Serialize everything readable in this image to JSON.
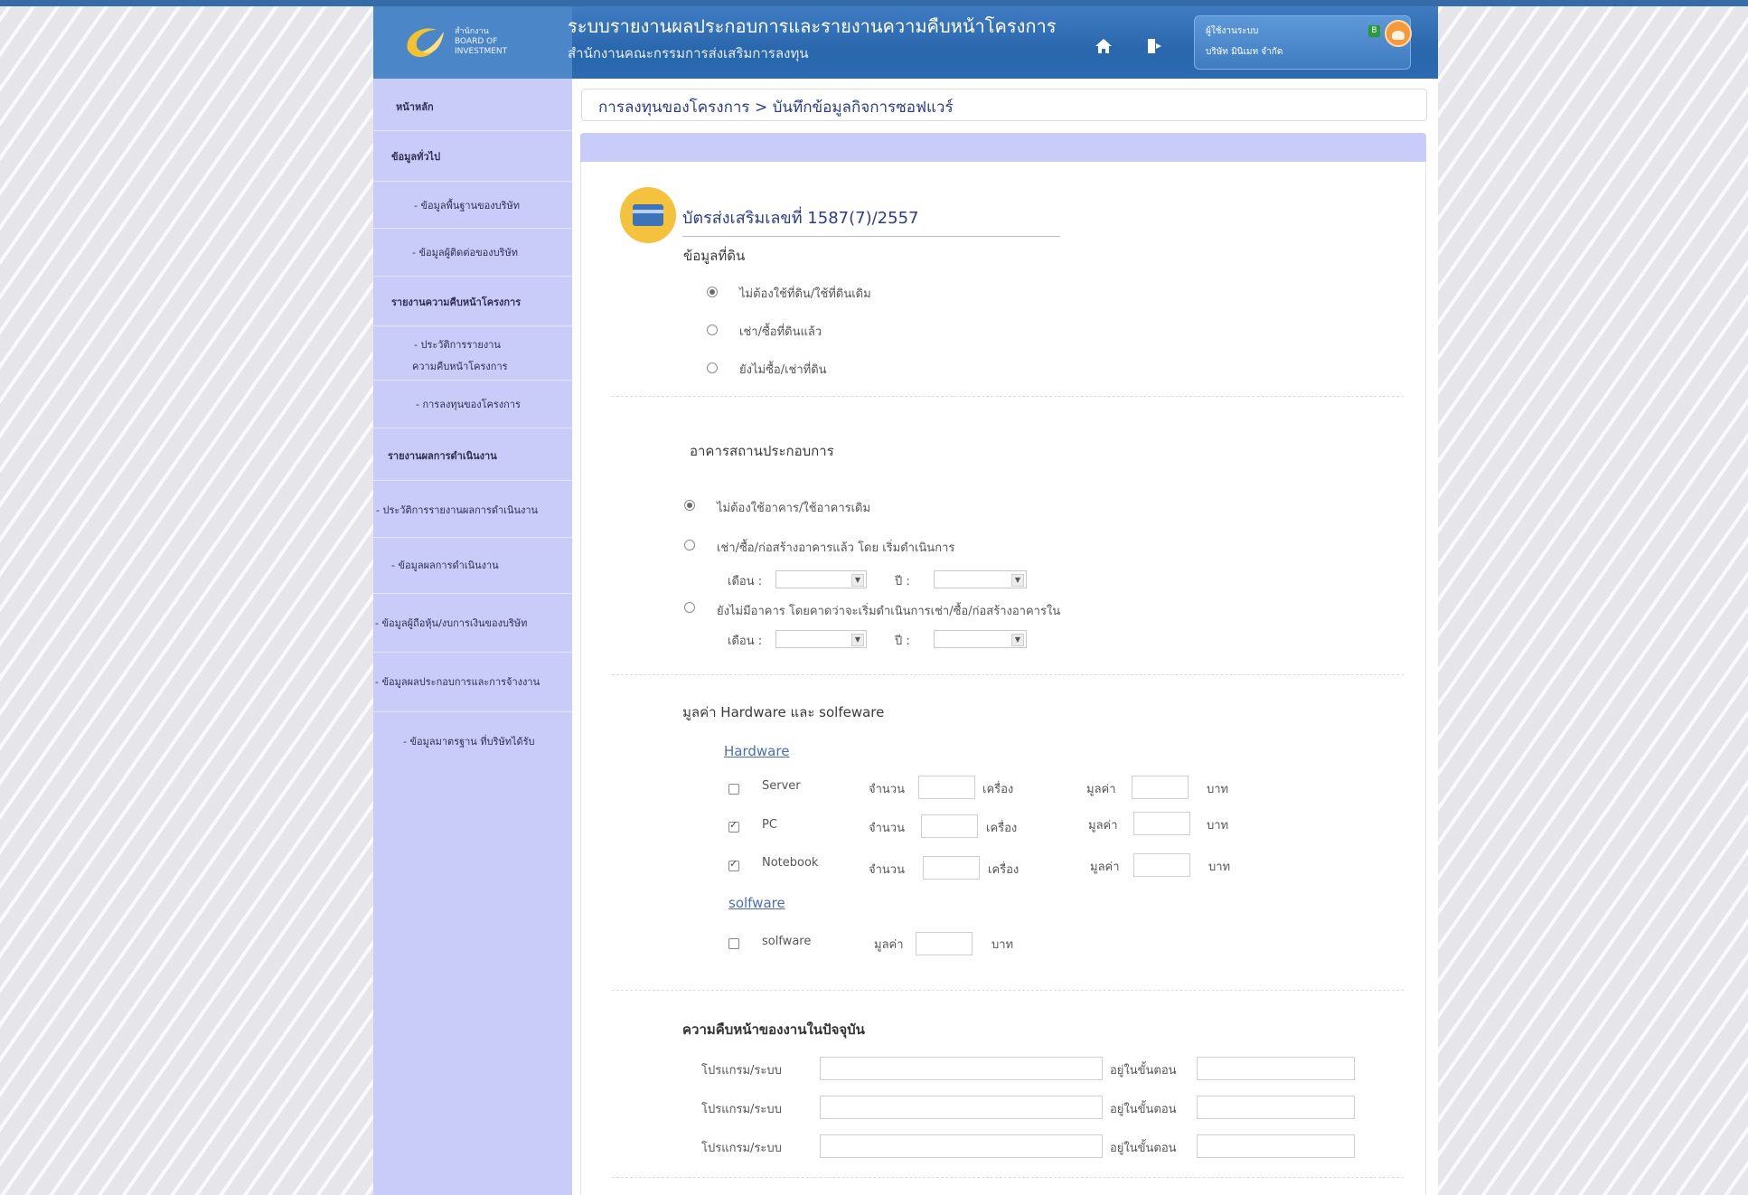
{
  "header": {
    "logo_line1": "สำนักงาน",
    "logo_line2": "BOARD OF",
    "logo_line3": "INVESTMENT",
    "system_title": "ระบบรายงานผลประกอบการและรายงานความคืบหน้าโครงการ",
    "system_subtitle": "สำนักงานคณะกรรมการส่งเสริมการลงทุน",
    "home_icon": "home-icon",
    "logout_icon": "logout-icon",
    "user_label": "ผู้ใช้งานระบบ",
    "user_company": "บริษัท มินิเมท จำกัด",
    "user_badge": "B",
    "accent": "#2b69b0"
  },
  "sidebar": {
    "items": [
      {
        "label": "หน้าหลัก"
      },
      {
        "label": "ข้อมูลทั่วไป"
      },
      {
        "label": "- ข้อมูลพื้นฐานของบริษัท"
      },
      {
        "label": "- ข้อมูลผู้ติดต่อของบริษัท"
      },
      {
        "label": "รายงานความคืบหน้าโครงการ"
      },
      {
        "label": "- ประวัติการรายงาน"
      },
      {
        "label": "ความคืบหน้าโครงการ"
      },
      {
        "label": "- การลงทุนของโครงการ"
      },
      {
        "label": "รายงานผลการดำเนินงาน"
      },
      {
        "label": "- ประวัติการรายงานผลการดำเนินงาน"
      },
      {
        "label": "- ข้อมูลผลการดำเนินงาน"
      },
      {
        "label": "- ข้อมูลผู้ถือหุ้น/งบการเงินของบริษัท"
      },
      {
        "label": "- ข้อมูลผลประกอบการและการจ้างงาน"
      },
      {
        "label": "- ข้อมูลมาตรฐาน ที่บริษัทได้รับ"
      }
    ],
    "bg": "#c9cbf8"
  },
  "breadcrumb": "การลงทุนของโครงการ > บันทึกข้อมูลกิจการซอฟแวร์",
  "card": {
    "title": "บัตรส่งเสริมเลขที่ 1587(7)/2557",
    "icon": "card-icon"
  },
  "land": {
    "title": "ข้อมูลที่ดิน",
    "options": [
      {
        "label": "ไม่ต้องใช้ที่ดิน/ใช้ที่ดินเดิม",
        "checked": true
      },
      {
        "label": "เช่า/ซื้อที่ดินแล้ว",
        "checked": false
      },
      {
        "label": "ยังไม่ซื้อ/เช่าที่ดิน",
        "checked": false
      }
    ]
  },
  "building": {
    "title": "อาคารสถานประกอบการ",
    "options": [
      {
        "label": "ไม่ต้องใช้อาคาร/ใช้อาคารเดิม",
        "checked": true
      },
      {
        "label": "เช่า/ซื้อ/ก่อสร้างอาคารแล้ว โดย  เริ่มดำเนินการ",
        "checked": false
      },
      {
        "label": "ยังไม่มีอาคาร โดยคาดว่าจะเริ่มดำเนินการเช่า/ซื้อ/ก่อสร้างอาคารใน",
        "checked": false
      }
    ],
    "month_label": "เดือน :",
    "year_label": "ปี :"
  },
  "value": {
    "title": "มูลค่า Hardware และ solfeware",
    "hardware_link": "Hardware",
    "software_link": "solfware",
    "qty_label": "จำนวน",
    "unit_machine": "เครื่อง",
    "value_label": "มูลค่า",
    "unit_baht": "บาท",
    "hardware": [
      {
        "name": "Server",
        "checked": false
      },
      {
        "name": "PC",
        "checked": true
      },
      {
        "name": "Notebook",
        "checked": true
      }
    ],
    "software": [
      {
        "name": "solfware",
        "checked": false
      }
    ]
  },
  "progress": {
    "title": "ความคืบหน้าของงานในปัจจุบัน",
    "program_label": "โปรแกรม/ระบบ",
    "stage_label": "อยู่ในขั้นตอน",
    "rows": 3
  }
}
